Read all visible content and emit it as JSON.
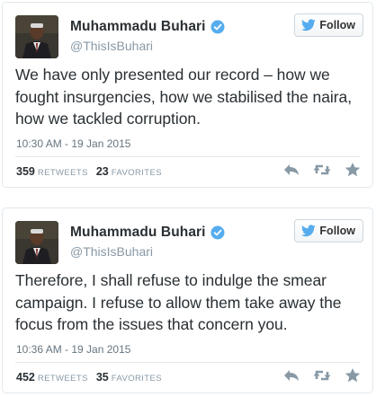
{
  "colors": {
    "text": "#292f33",
    "muted": "#8899a6",
    "verified": "#55acee",
    "twitter_blue": "#55acee",
    "border": "#e1e8ed",
    "action_icon": "#8899a6"
  },
  "tweets": [
    {
      "author_name": "Muhammadu Buhari",
      "handle": "@ThisIsBuhari",
      "verified": true,
      "follow_label": "Follow",
      "text": "We have only presented our record – how we fought insurgencies, how we stabilised the naira, how we tackled corruption.",
      "timestamp": "10:30 AM - 19 Jan 2015",
      "retweets": "359",
      "retweets_label": "RETWEETS",
      "favorites": "23",
      "favorites_label": "FAVORITES",
      "icons": [
        "reply-icon",
        "retweet-icon",
        "favorite-icon"
      ]
    },
    {
      "author_name": "Muhammadu Buhari",
      "handle": "@ThisIsBuhari",
      "verified": true,
      "follow_label": "Follow",
      "text": "Therefore, I shall refuse to indulge the smear campaign. I refuse to allow them take away the focus from the issues that concern you.",
      "timestamp": "10:36 AM - 19 Jan 2015",
      "retweets": "452",
      "retweets_label": "RETWEETS",
      "favorites": "35",
      "favorites_label": "FAVORITES",
      "icons": [
        "reply-icon",
        "retweet-icon",
        "favorite-icon"
      ]
    }
  ]
}
